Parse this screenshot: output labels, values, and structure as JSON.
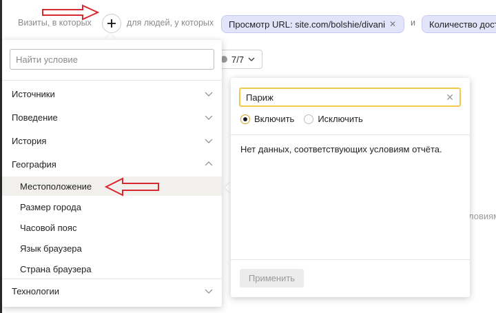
{
  "filter": {
    "prefix": "Визиты, в которых",
    "middle": "для людей, у которых",
    "chip1": "Просмотр URL: site.com/bolshie/divani",
    "conj": "и",
    "chip2": "Количество дост"
  },
  "count_selector": {
    "value": "7/7"
  },
  "background_text": "ловиям",
  "dropdown": {
    "search_placeholder": "Найти условие",
    "categories": [
      {
        "label": "Источники",
        "expanded": false
      },
      {
        "label": "Поведение",
        "expanded": false
      },
      {
        "label": "История",
        "expanded": false
      },
      {
        "label": "География",
        "expanded": true
      },
      {
        "label": "Технологии",
        "expanded": false
      }
    ],
    "geo_items": [
      "Местоположение",
      "Размер города",
      "Часовой пояс",
      "Язык браузера",
      "Страна браузера"
    ],
    "active_item": "Местоположение"
  },
  "condition": {
    "input_value": "Париж",
    "options": [
      "Включить",
      "Исключить"
    ],
    "selected_option": "Включить",
    "empty_message": "Нет данных, соответствующих условиям отчёта.",
    "apply_label": "Применить"
  },
  "colors": {
    "chip_bg": "#e2e5f9",
    "focus_border": "#f2c94c",
    "annotation_arrow": "#d9282f",
    "active_row_bg": "#f1f0ed"
  }
}
